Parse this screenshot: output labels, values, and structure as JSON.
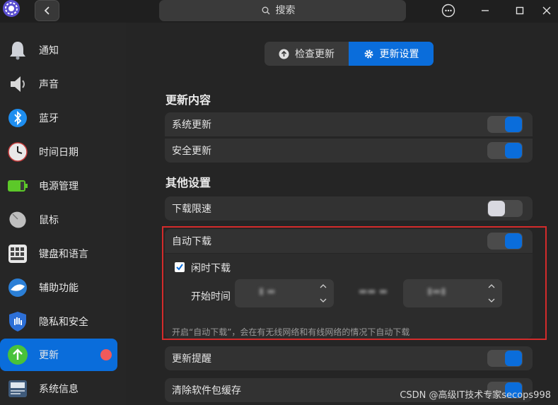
{
  "search": {
    "placeholder": "搜索"
  },
  "sidebar": {
    "items": [
      {
        "label": "通知",
        "icon": "bell-icon"
      },
      {
        "label": "声音",
        "icon": "speaker-icon"
      },
      {
        "label": "蓝牙",
        "icon": "bluetooth-icon"
      },
      {
        "label": "时间日期",
        "icon": "clock-icon"
      },
      {
        "label": "电源管理",
        "icon": "battery-icon"
      },
      {
        "label": "鼠标",
        "icon": "mouse-icon"
      },
      {
        "label": "键盘和语言",
        "icon": "keyboard-icon"
      },
      {
        "label": "辅助功能",
        "icon": "accessibility-icon"
      },
      {
        "label": "隐私和安全",
        "icon": "shield-hand-icon"
      },
      {
        "label": "更新",
        "icon": "update-arrow-icon",
        "active": true
      },
      {
        "label": "系统信息",
        "icon": "system-info-icon"
      }
    ]
  },
  "tabs": {
    "check": "检查更新",
    "settings": "更新设置"
  },
  "sections": {
    "update_content": "更新内容",
    "other_settings": "其他设置"
  },
  "rows": {
    "system_update": {
      "label": "系统更新",
      "on": true
    },
    "security_update": {
      "label": "安全更新",
      "on": true
    },
    "speed_limit": {
      "label": "下载限速",
      "on": false
    },
    "auto_download": {
      "label": "自动下载",
      "on": true
    },
    "update_reminder": {
      "label": "更新提醒",
      "on": true
    },
    "clear_cache": {
      "label": "清除软件包缓存",
      "on": true
    }
  },
  "auto_download_panel": {
    "idle_label": "闲时下载",
    "idle_checked": true,
    "start_time_label": "开始时间",
    "hint": "开启“自动下载”，会在有无线网络和有线网络的情况下自动下载"
  },
  "colors": {
    "accent": "#0a6ddb",
    "badge": "#f05a5a",
    "highlight": "#d42b2b"
  },
  "watermark": "CSDN @高级IT技术专家secops998"
}
